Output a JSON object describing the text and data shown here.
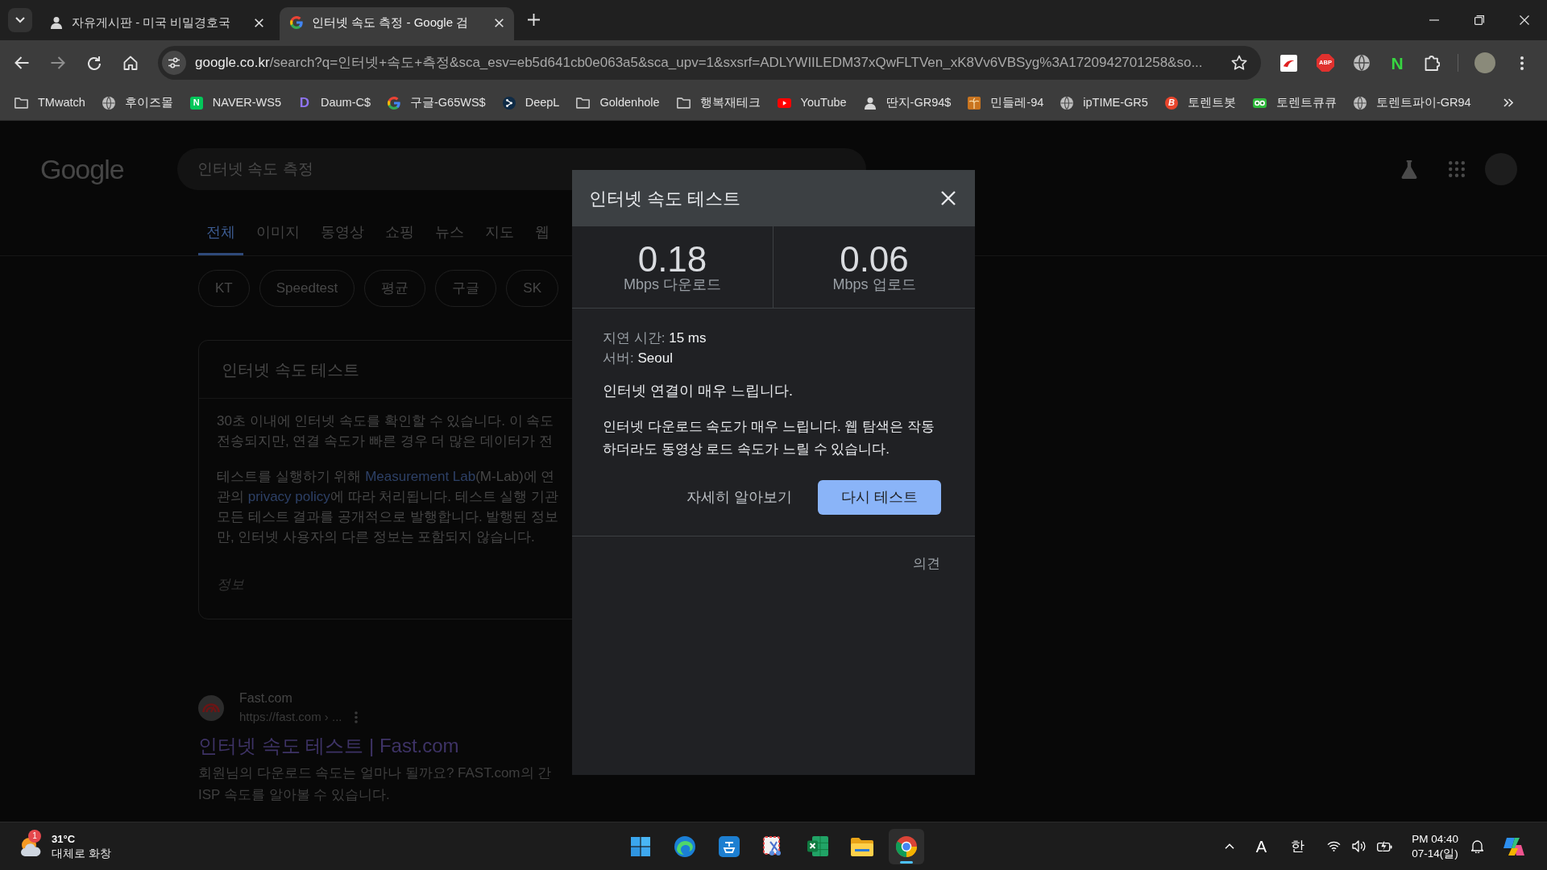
{
  "browser": {
    "tabs": [
      {
        "title": "자유게시판 - 미국 비밀경호국",
        "kind": "figure",
        "selected": false
      },
      {
        "title": "인터넷 속도 측정 - Google 검",
        "kind": "gmark",
        "selected": true
      }
    ],
    "url": {
      "host": "google.co.kr",
      "rest": "/search?q=인터넷+속도+측정&sca_esv=eb5d641cb0e063a5&sca_upv=1&sxsrf=ADLYWIILEDM37xQwFLTVen_xK8Vv6VBSyg%3A1720942701258&so..."
    },
    "extensions": [
      {
        "kind": "tile"
      },
      {
        "kind": "octagon",
        "mark": "ABP"
      },
      {
        "kind": "globe"
      },
      {
        "kind": "letter",
        "mark": "N"
      }
    ],
    "bookmarks": [
      {
        "label": "TMwatch",
        "kind": "folder"
      },
      {
        "label": "후이즈몰",
        "kind": "globe"
      },
      {
        "label": "NAVER-WS5",
        "kind": "lettertile",
        "mark": "N"
      },
      {
        "label": "Daum-C$",
        "kind": "letterplain",
        "mark": "D"
      },
      {
        "label": "구글-G65WS$",
        "kind": "gmark"
      },
      {
        "label": "DeepL",
        "kind": "nodes"
      },
      {
        "label": "Goldenhole",
        "kind": "folder"
      },
      {
        "label": "행복재테크",
        "kind": "folder"
      },
      {
        "label": "YouTube",
        "kind": "play"
      },
      {
        "label": "딴지-GR94$",
        "kind": "figure"
      },
      {
        "label": "민들레-94",
        "kind": "palm"
      },
      {
        "label": "ipTIME-GR5",
        "kind": "globe"
      },
      {
        "label": "토렌트봇",
        "kind": "lettercircle",
        "mark": "B"
      },
      {
        "label": "토렌트큐큐",
        "kind": "goggles"
      },
      {
        "label": "토렌트파이-GR94",
        "kind": "globe"
      }
    ]
  },
  "google": {
    "logo": "Google",
    "query": "인터넷 속도 측정",
    "nav": [
      {
        "label": "전체",
        "selected": true
      },
      {
        "label": "이미지",
        "selected": false
      },
      {
        "label": "동영상",
        "selected": false
      },
      {
        "label": "쇼핑",
        "selected": false
      },
      {
        "label": "뉴스",
        "selected": false
      },
      {
        "label": "지도",
        "selected": false
      },
      {
        "label": "웹",
        "selected": false
      }
    ],
    "chips": [
      "KT",
      "Speedtest",
      "평균",
      "구글",
      "SK"
    ],
    "card": {
      "title": "인터넷 속도 테스트",
      "paragraphs": [
        {
          "lines": [
            [
              {
                "text": "30초 이내에 인터넷 속도를 확인할 수 있습니다. 이 속도",
                "kind": "plain"
              }
            ],
            [
              {
                "text": "전송되지만, 연결 속도가 빠른 경우 더 많은 데이터가 전",
                "kind": "plain"
              }
            ]
          ]
        },
        {
          "lines": [
            [
              {
                "text": "테스트를 실행하기 위해 ",
                "kind": "plain"
              },
              {
                "text": "Measurement Lab",
                "kind": "link"
              },
              {
                "text": "(M-Lab)에 연",
                "kind": "plain"
              }
            ],
            [
              {
                "text": "관의 ",
                "kind": "plain"
              },
              {
                "text": "privacy policy",
                "kind": "link"
              },
              {
                "text": "에 따라 처리됩니다. 테스트 실행 기관",
                "kind": "plain"
              }
            ],
            [
              {
                "text": "모든 테스트 결과를 공개적으로 발행합니다. 발행된 정보",
                "kind": "plain"
              }
            ],
            [
              {
                "text": "만, 인터넷 사용자의 다른 정보는 포함되지 않습니다.",
                "kind": "plain"
              }
            ]
          ]
        }
      ],
      "footer": "정보"
    },
    "result": {
      "site": "Fast.com",
      "url": "https://fast.com › ...",
      "title": "인터넷 속도 테스트 | Fast.com",
      "snippet": [
        "회원님의 다운로드 속도는 얼마나 될까요? FAST.com의 간",
        "ISP 속도를 알아볼 수 있습니다."
      ]
    }
  },
  "dialog": {
    "title": "인터넷 속도 테스트",
    "stats": [
      {
        "value": "0.18",
        "unit": "Mbps 다운로드"
      },
      {
        "value": "0.06",
        "unit": "Mbps 업로드"
      }
    ],
    "details": [
      {
        "label": "지연 시간:",
        "value": "15 ms"
      },
      {
        "label": "서버:",
        "value": "Seoul"
      }
    ],
    "headline": "인터넷 연결이 매우 느립니다.",
    "message": "인터넷 다운로드 속도가 매우 느립니다. 웹 탐색은 작동하더라도 동영상 로드 속도가 느릴 수 있습니다.",
    "actions": [
      {
        "label": "자세히 알아보기",
        "kind": "text"
      },
      {
        "label": "다시 테스트",
        "kind": "filled"
      }
    ],
    "feedback": "의견"
  },
  "taskbar": {
    "weather": {
      "badge": "1",
      "temperature": "31°C",
      "condition": "대체로 화창"
    },
    "apps": [
      {
        "kind": "start",
        "active": false
      },
      {
        "kind": "wave",
        "active": false
      },
      {
        "kind": "tile",
        "active": false
      },
      {
        "kind": "snip",
        "active": false
      },
      {
        "kind": "sheet",
        "active": false
      },
      {
        "kind": "files",
        "active": false
      },
      {
        "kind": "ring",
        "active": true
      }
    ],
    "tray": {
      "ime_mode": "A",
      "ime_language": "한"
    },
    "clock": {
      "time": "PM 04:40",
      "date": "07-14(일)"
    }
  }
}
